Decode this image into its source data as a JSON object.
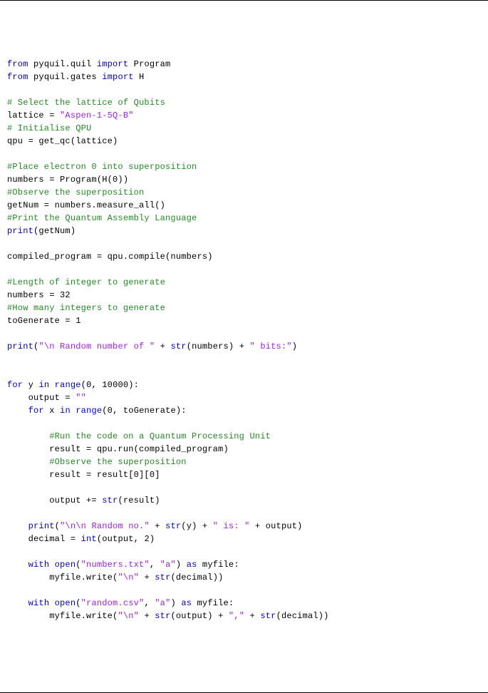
{
  "code": {
    "lines": [
      [
        [
          "kw",
          "from"
        ],
        [
          "plain",
          " pyquil.quil "
        ],
        [
          "kw",
          "import"
        ],
        [
          "plain",
          " Program"
        ]
      ],
      [
        [
          "kw",
          "from"
        ],
        [
          "plain",
          " pyquil.gates "
        ],
        [
          "kw",
          "import"
        ],
        [
          "plain",
          " H"
        ]
      ],
      [
        [
          "plain",
          ""
        ]
      ],
      [
        [
          "cm",
          "# Select the lattice of Qubits"
        ]
      ],
      [
        [
          "plain",
          "lattice = "
        ],
        [
          "str",
          "\"Aspen-1-5Q-B\""
        ]
      ],
      [
        [
          "cm",
          "# Initialise QPU"
        ]
      ],
      [
        [
          "plain",
          "qpu = get_qc(lattice)"
        ]
      ],
      [
        [
          "plain",
          ""
        ]
      ],
      [
        [
          "cm",
          "#Place electron 0 into superposition"
        ]
      ],
      [
        [
          "plain",
          "numbers = Program(H(0))"
        ]
      ],
      [
        [
          "cm",
          "#Observe the superposition"
        ]
      ],
      [
        [
          "plain",
          "getNum = numbers.measure_all()"
        ]
      ],
      [
        [
          "cm",
          "#Print the Quantum Assembly Language"
        ]
      ],
      [
        [
          "fn",
          "print"
        ],
        [
          "plain",
          "(getNum)"
        ]
      ],
      [
        [
          "plain",
          ""
        ]
      ],
      [
        [
          "plain",
          "compiled_program = qpu.compile(numbers)"
        ]
      ],
      [
        [
          "plain",
          ""
        ]
      ],
      [
        [
          "cm",
          "#Length of integer to generate"
        ]
      ],
      [
        [
          "plain",
          "numbers = 32"
        ]
      ],
      [
        [
          "cm",
          "#How many integers to generate"
        ]
      ],
      [
        [
          "plain",
          "toGenerate = 1"
        ]
      ],
      [
        [
          "plain",
          ""
        ]
      ],
      [
        [
          "fn",
          "print"
        ],
        [
          "plain",
          "("
        ],
        [
          "str",
          "\"\\n Random number of \""
        ],
        [
          "plain",
          " + "
        ],
        [
          "fn",
          "str"
        ],
        [
          "plain",
          "(numbers) + "
        ],
        [
          "str",
          "\" bits:\""
        ],
        [
          "plain",
          ")"
        ]
      ],
      [
        [
          "plain",
          ""
        ]
      ],
      [
        [
          "plain",
          ""
        ]
      ],
      [
        [
          "kw",
          "for"
        ],
        [
          "plain",
          " y "
        ],
        [
          "kw",
          "in"
        ],
        [
          "plain",
          " "
        ],
        [
          "fn",
          "range"
        ],
        [
          "plain",
          "(0, 10000):"
        ]
      ],
      [
        [
          "plain",
          "    output = "
        ],
        [
          "str",
          "\"\""
        ]
      ],
      [
        [
          "plain",
          "    "
        ],
        [
          "kw",
          "for"
        ],
        [
          "plain",
          " x "
        ],
        [
          "kw",
          "in"
        ],
        [
          "plain",
          " "
        ],
        [
          "fn",
          "range"
        ],
        [
          "plain",
          "(0, toGenerate):"
        ]
      ],
      [
        [
          "plain",
          ""
        ]
      ],
      [
        [
          "plain",
          "        "
        ],
        [
          "cm",
          "#Run the code on a Quantum Processing Unit"
        ]
      ],
      [
        [
          "plain",
          "        result = qpu.run(compiled_program)"
        ]
      ],
      [
        [
          "plain",
          "        "
        ],
        [
          "cm",
          "#Observe the superposition"
        ]
      ],
      [
        [
          "plain",
          "        result = result[0][0]"
        ]
      ],
      [
        [
          "plain",
          ""
        ]
      ],
      [
        [
          "plain",
          "        output += "
        ],
        [
          "fn",
          "str"
        ],
        [
          "plain",
          "(result)"
        ]
      ],
      [
        [
          "plain",
          ""
        ]
      ],
      [
        [
          "plain",
          "    "
        ],
        [
          "fn",
          "print"
        ],
        [
          "plain",
          "("
        ],
        [
          "str",
          "\"\\n\\n Random no.\""
        ],
        [
          "plain",
          " + "
        ],
        [
          "fn",
          "str"
        ],
        [
          "plain",
          "(y) + "
        ],
        [
          "str",
          "\" is: \""
        ],
        [
          "plain",
          " + output)"
        ]
      ],
      [
        [
          "plain",
          "    decimal = "
        ],
        [
          "fn",
          "int"
        ],
        [
          "plain",
          "(output, 2)"
        ]
      ],
      [
        [
          "plain",
          ""
        ]
      ],
      [
        [
          "plain",
          "    "
        ],
        [
          "kw",
          "with"
        ],
        [
          "plain",
          " "
        ],
        [
          "fn",
          "open"
        ],
        [
          "plain",
          "("
        ],
        [
          "str",
          "\"numbers.txt\""
        ],
        [
          "plain",
          ", "
        ],
        [
          "str",
          "\"a\""
        ],
        [
          "plain",
          ") "
        ],
        [
          "kw",
          "as"
        ],
        [
          "plain",
          " myfile:"
        ]
      ],
      [
        [
          "plain",
          "        myfile.write("
        ],
        [
          "str",
          "\"\\n\""
        ],
        [
          "plain",
          " + "
        ],
        [
          "fn",
          "str"
        ],
        [
          "plain",
          "(decimal))"
        ]
      ],
      [
        [
          "plain",
          ""
        ]
      ],
      [
        [
          "plain",
          "    "
        ],
        [
          "kw",
          "with"
        ],
        [
          "plain",
          " "
        ],
        [
          "fn",
          "open"
        ],
        [
          "plain",
          "("
        ],
        [
          "str",
          "\"random.csv\""
        ],
        [
          "plain",
          ", "
        ],
        [
          "str",
          "\"a\""
        ],
        [
          "plain",
          ") "
        ],
        [
          "kw",
          "as"
        ],
        [
          "plain",
          " myfile:"
        ]
      ],
      [
        [
          "plain",
          "        myfile.write("
        ],
        [
          "str",
          "\"\\n\""
        ],
        [
          "plain",
          " + "
        ],
        [
          "fn",
          "str"
        ],
        [
          "plain",
          "(output) + "
        ],
        [
          "str",
          "\",\""
        ],
        [
          "plain",
          " + "
        ],
        [
          "fn",
          "str"
        ],
        [
          "plain",
          "(decimal))"
        ]
      ]
    ]
  }
}
